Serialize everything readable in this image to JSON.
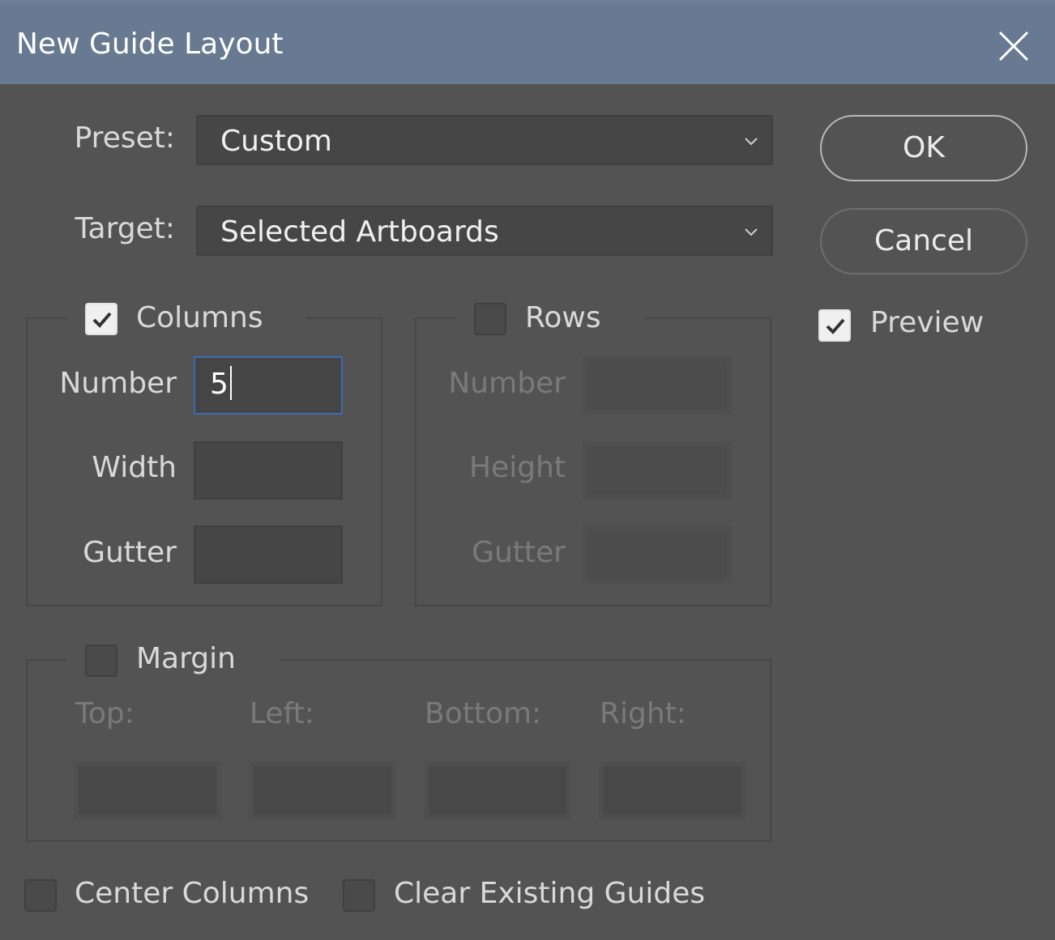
{
  "window": {
    "title": "New Guide Layout"
  },
  "preset": {
    "label": "Preset:",
    "value": "Custom"
  },
  "target": {
    "label": "Target:",
    "value": "Selected Artboards"
  },
  "buttons": {
    "ok": "OK",
    "cancel": "Cancel"
  },
  "preview": {
    "label": "Preview",
    "checked": true
  },
  "columns": {
    "label": "Columns",
    "checked": true,
    "number_label": "Number",
    "number_value": "5",
    "width_label": "Width",
    "width_value": "",
    "gutter_label": "Gutter",
    "gutter_value": ""
  },
  "rows": {
    "label": "Rows",
    "checked": false,
    "number_label": "Number",
    "height_label": "Height",
    "gutter_label": "Gutter"
  },
  "margin": {
    "label": "Margin",
    "checked": false,
    "top_label": "Top:",
    "left_label": "Left:",
    "bottom_label": "Bottom:",
    "right_label": "Right:"
  },
  "options": {
    "center_columns": "Center Columns",
    "clear_existing_guides": "Clear Existing Guides"
  },
  "icons": {
    "close": "close-icon",
    "chevron": "chevron-down-icon",
    "check": "checkmark-icon"
  },
  "colors": {
    "titlebar": "#687a91",
    "background": "#535353",
    "focus_border": "#3a6cb5"
  }
}
